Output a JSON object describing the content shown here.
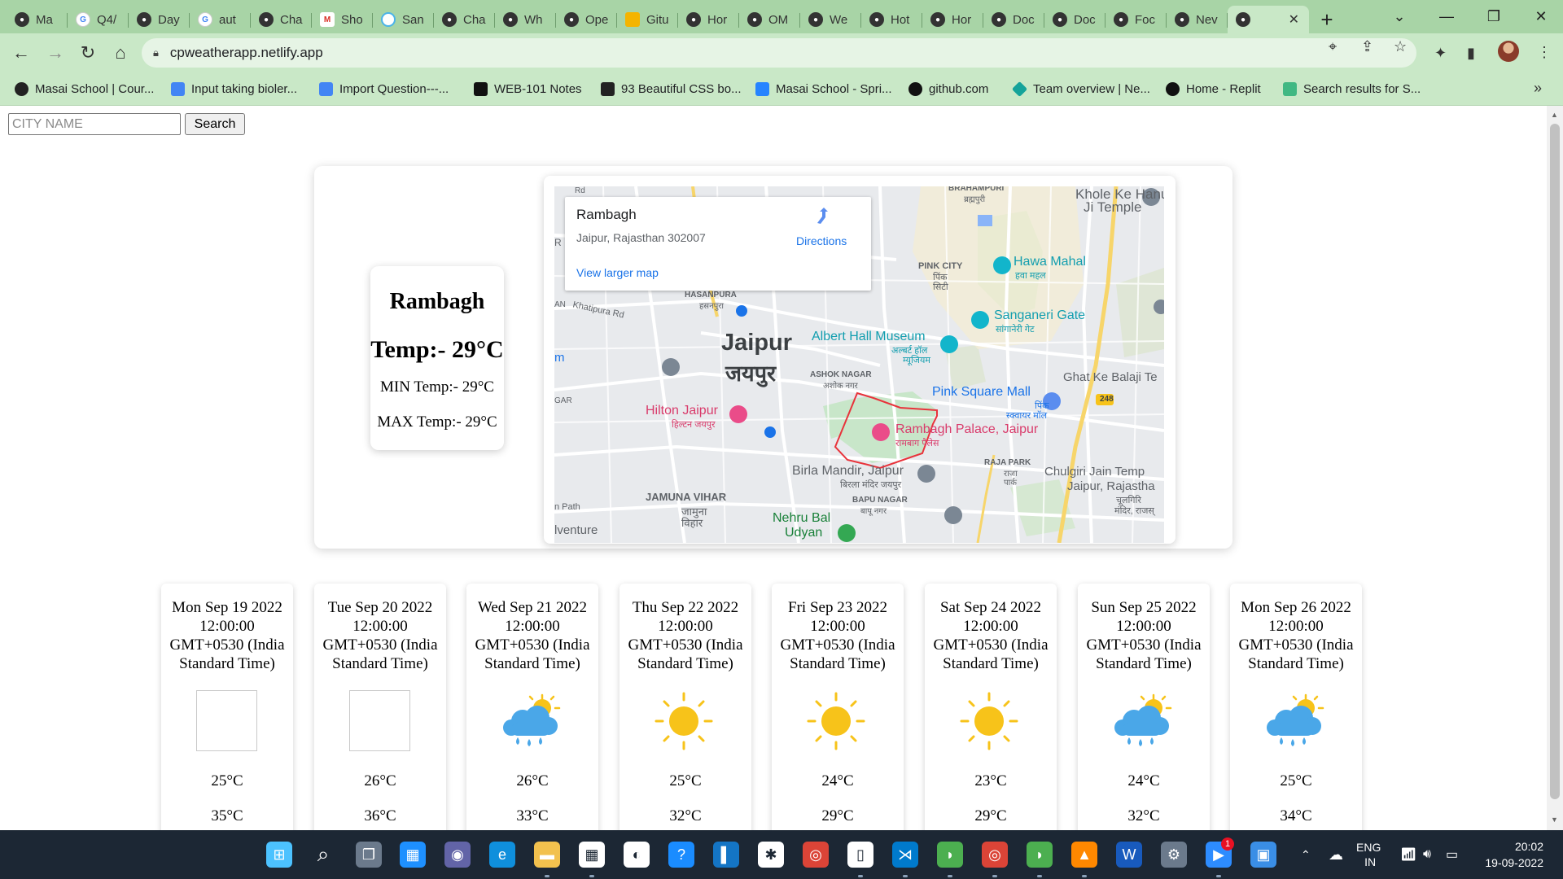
{
  "browser": {
    "tabs": [
      {
        "label": "Ma",
        "icon": "github-icon"
      },
      {
        "label": "Q4/",
        "icon": "google-icon"
      },
      {
        "label": "Day",
        "icon": "github-icon"
      },
      {
        "label": "aut",
        "icon": "google-icon"
      },
      {
        "label": "Cha",
        "icon": "github-icon"
      },
      {
        "label": "Sho",
        "icon": "gmail-icon"
      },
      {
        "label": "San",
        "icon": "loading-icon"
      },
      {
        "label": "Cha",
        "icon": "github-icon"
      },
      {
        "label": "Wh",
        "icon": "github-icon"
      },
      {
        "label": "Ope",
        "icon": "github-icon"
      },
      {
        "label": "Gitu",
        "icon": "slides-icon"
      },
      {
        "label": "Hor",
        "icon": "github-icon"
      },
      {
        "label": "OM",
        "icon": "github-icon"
      },
      {
        "label": "We",
        "icon": "github-icon"
      },
      {
        "label": "Hot",
        "icon": "github-icon"
      },
      {
        "label": "Hor",
        "icon": "github-icon"
      },
      {
        "label": "Doc",
        "icon": "github-icon"
      },
      {
        "label": "Doc",
        "icon": "github-icon"
      },
      {
        "label": "Foc",
        "icon": "github-icon"
      },
      {
        "label": "Nev",
        "icon": "github-icon"
      }
    ],
    "active_tab": {
      "label": "",
      "icon": "github-icon"
    },
    "url": "cpweatherapp.netlify.app",
    "bookmarks": [
      {
        "label": "Masai School | Cour...",
        "icon": "github-icon",
        "color": "#222222"
      },
      {
        "label": "Input taking bioler...",
        "icon": "docs-icon",
        "color": "#4285f4"
      },
      {
        "label": "Import Question---...",
        "icon": "docs-icon",
        "color": "#4285f4"
      },
      {
        "label": "WEB-101 Notes",
        "icon": "notion-icon",
        "color": "#111111"
      },
      {
        "label": "93 Beautiful CSS bo...",
        "icon": "css-icon",
        "color": "#222222"
      },
      {
        "label": "Masai School - Spri...",
        "icon": "jira-icon",
        "color": "#2684ff"
      },
      {
        "label": "github.com",
        "icon": "github-icon",
        "color": "#111111"
      },
      {
        "label": "Team overview | Ne...",
        "icon": "netlify-icon",
        "color": "#15a39a"
      },
      {
        "label": "Home - Replit",
        "icon": "replit-icon",
        "color": "#111111"
      },
      {
        "label": "Search results for S...",
        "icon": "vue-icon",
        "color": "#41b883"
      }
    ]
  },
  "search": {
    "placeholder": "CITY NAME",
    "value": "",
    "button": "Search"
  },
  "current": {
    "place": "Rambagh",
    "temp": "Temp:- 29°C",
    "min": "MIN Temp:- 29°C",
    "max": "MAX Temp:- 29°C"
  },
  "map": {
    "popup_title": "Rambagh",
    "popup_address": "Jaipur, Rajasthan 302007",
    "popup_directions": "Directions",
    "popup_larger": "View larger map",
    "labels": {
      "city_en": "Jaipur",
      "city_hi": "जयपुर",
      "hawa_mahal": "Hawa Mahal",
      "hawa_mahal_hi": "हवा महल",
      "khole": "Khole Ke Hanuman",
      "khole2": "Ji Temple",
      "brahampuri": "BRAHAMPURI",
      "brahampuri_hi": "ब्रह्मपुरी",
      "pink_city": "PINK CITY",
      "pink_city_hi": "पिंक",
      "pink_city_hi2": "सिटी",
      "sanganeri": "Sanganeri Gate",
      "sanganeri_hi": "सांगानेरी गेट",
      "albert": "Albert Hall Museum",
      "albert_hi": "अल्बर्ट हॉल",
      "albert_hi2": "म्यूजियम",
      "hasanpura": "HASANPURA",
      "hasanpura_hi": "हसनपुरा",
      "khatipura": "Khatipura Rd",
      "ashok": "ASHOK NAGAR",
      "ashok_hi": "अशोक नगर",
      "ghat": "Ghat Ke Balaji Te",
      "pink_square": "Pink Square Mall",
      "pink_square_hi": "पिंक",
      "pink_square_hi2": "स्क्वायर मॉल",
      "hilton": "Hilton Jaipur",
      "hilton_hi": "हिल्टन जयपुर",
      "rambagh_palace": "Rambagh Palace, Jaipur",
      "rambagh_palace_hi": "रामबाग पैलेस",
      "raja_park": "RAJA PARK",
      "raja_park_hi": "राजा",
      "raja_park_hi2": "पार्क",
      "chulgiri": "Chulgiri Jain Temp",
      "chulgiri2": "Jaipur, Rajastha",
      "chulgiri_hi": "चूलगिरि",
      "chulgiri_hi2": "मंदिर, राजस्",
      "birla": "Birla Mandir, Jaipur",
      "birla_hi": "बिरला मंदिर जयपुर",
      "jamuna": "JAMUNA VIHAR",
      "jamuna_hi": "जामुना",
      "jamuna_hi2": "विहार",
      "bapu": "BAPU NAGAR",
      "bapu_hi": "बापू नगर",
      "nehru": "Nehru Bal",
      "nehru2": "Udyan",
      "road_248": "248",
      "gar": "GAR",
      "venture": "lventure",
      "path": "n Path",
      "edge_m": "m",
      "edge_an": "AN",
      "edge_rd": "Rd",
      "edge_r": "R"
    }
  },
  "forecast": [
    {
      "date": "Mon Sep 19 2022 12:00:00 GMT+0530 (India Standard Time)",
      "icon": "empty",
      "min": "25°C",
      "max": "35°C"
    },
    {
      "date": "Tue Sep 20 2022 12:00:00 GMT+0530 (India Standard Time)",
      "icon": "empty",
      "min": "26°C",
      "max": "36°C"
    },
    {
      "date": "Wed Sep 21 2022 12:00:00 GMT+0530 (India Standard Time)",
      "icon": "rain",
      "min": "26°C",
      "max": "33°C"
    },
    {
      "date": "Thu Sep 22 2022 12:00:00 GMT+0530 (India Standard Time)",
      "icon": "sun",
      "min": "25°C",
      "max": "32°C"
    },
    {
      "date": "Fri Sep 23 2022 12:00:00 GMT+0530 (India Standard Time)",
      "icon": "sun",
      "min": "24°C",
      "max": "29°C"
    },
    {
      "date": "Sat Sep 24 2022 12:00:00 GMT+0530 (India Standard Time)",
      "icon": "sun",
      "min": "23°C",
      "max": "29°C"
    },
    {
      "date": "Sun Sep 25 2022 12:00:00 GMT+0530 (India Standard Time)",
      "icon": "rain",
      "min": "24°C",
      "max": "32°C"
    },
    {
      "date": "Mon Sep 26 2022 12:00:00 GMT+0530 (India Standard Time)",
      "icon": "rain",
      "min": "25°C",
      "max": "34°C"
    }
  ],
  "taskbar": {
    "apps": [
      "windows-start-icon",
      "search-icon",
      "task-view-icon",
      "widgets-icon",
      "teams-chat-icon",
      "edge-icon",
      "file-explorer-icon",
      "store-icon",
      "github-desktop-icon",
      "help-icon",
      "vscode-blue-icon",
      "slack-icon",
      "chrome-icon",
      "notepad-icon",
      "vscode-icon",
      "app-green-icon",
      "chrome-active-icon",
      "app-green2-icon",
      "vlc-icon",
      "word-icon",
      "settings-icon",
      "zoom-icon",
      "photos-icon"
    ],
    "zoom_badge": "1",
    "lang": "ENG",
    "region": "IN",
    "time": "20:02",
    "date": "19-09-2022"
  },
  "colors": {
    "tabstrip": "#a8d4a6",
    "toolbar": "#c9e8c7",
    "taskbar": "#1c2734",
    "sun": "#f7c31a",
    "cloud": "#4aa7e8",
    "link": "#1a73e8"
  }
}
